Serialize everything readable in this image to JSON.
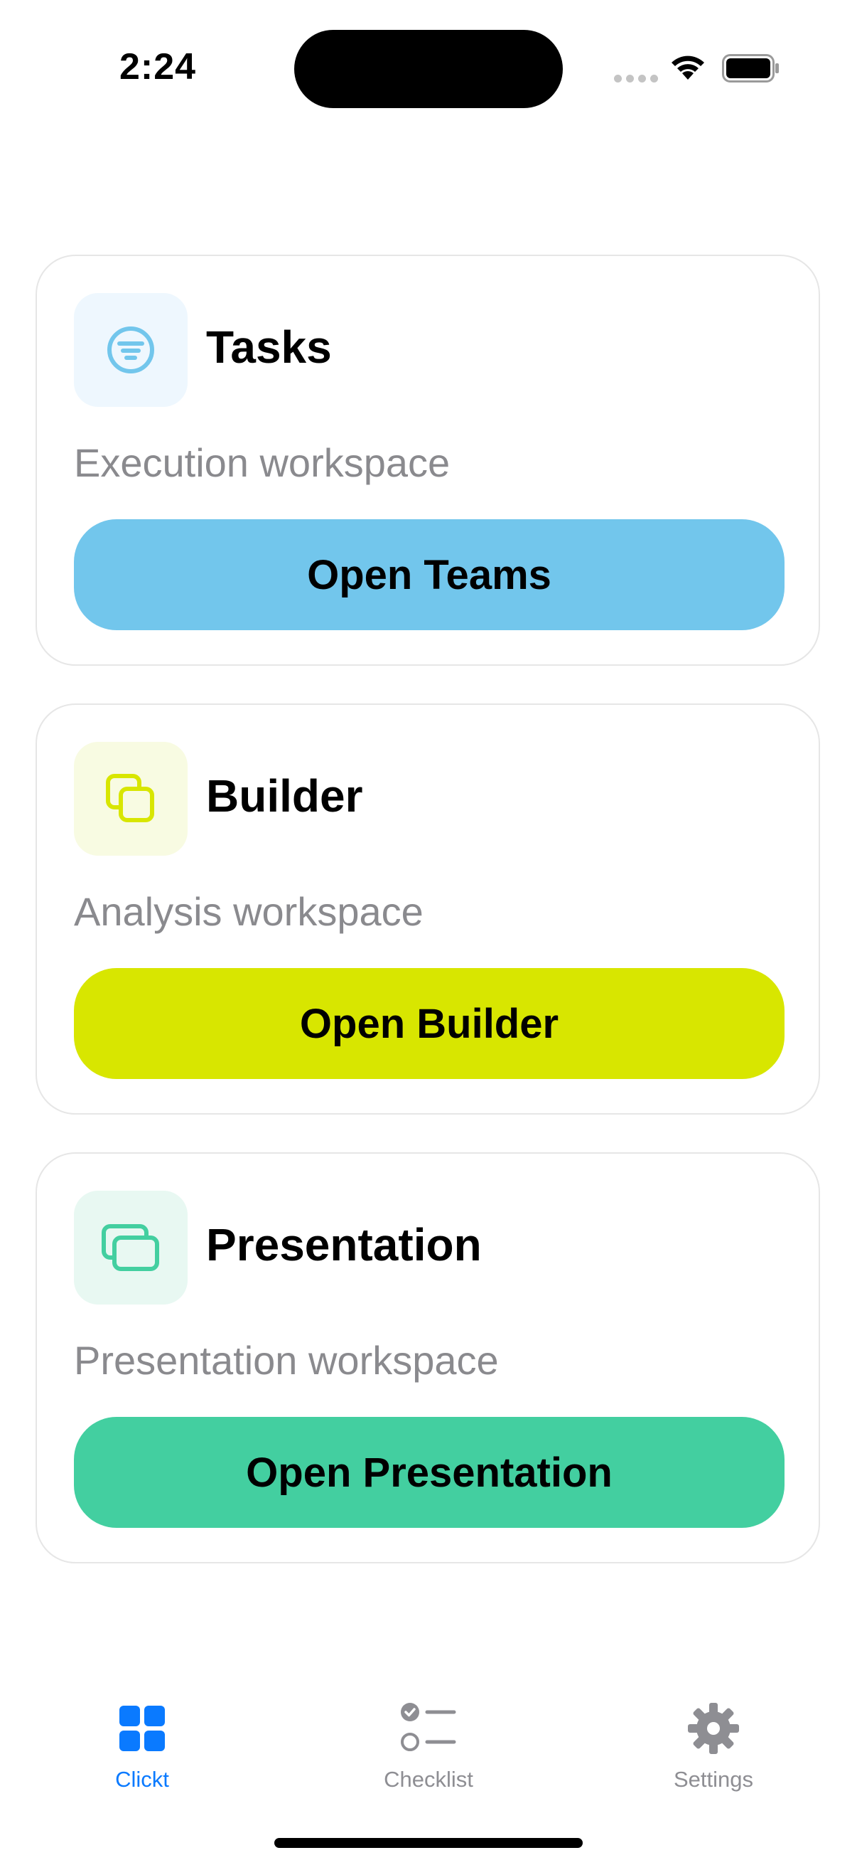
{
  "status_bar": {
    "time": "2:24"
  },
  "cards": [
    {
      "id": "tasks",
      "title": "Tasks",
      "subtitle": "Execution workspace",
      "button_label": "Open Teams",
      "icon": "filter-circle-icon",
      "accent": "#72C6EC",
      "tile_bg": "#EEF7FE"
    },
    {
      "id": "builder",
      "title": "Builder",
      "subtitle": "Analysis workspace",
      "button_label": "Open Builder",
      "icon": "copy-squares-icon",
      "accent": "#D8E600",
      "tile_bg": "#F8FBE2"
    },
    {
      "id": "presentation",
      "title": "Presentation",
      "subtitle": "Presentation workspace",
      "button_label": "Open Presentation",
      "icon": "stacked-windows-icon",
      "accent": "#43CFA0",
      "tile_bg": "#E8F8F2"
    }
  ],
  "tab_bar": {
    "active_color": "#0A7AFF",
    "inactive_color": "#8E8E93",
    "tabs": [
      {
        "label": "Clickt",
        "icon": "grid-icon",
        "active": true
      },
      {
        "label": "Checklist",
        "icon": "checklist-icon",
        "active": false
      },
      {
        "label": "Settings",
        "icon": "gear-icon",
        "active": false
      }
    ]
  }
}
